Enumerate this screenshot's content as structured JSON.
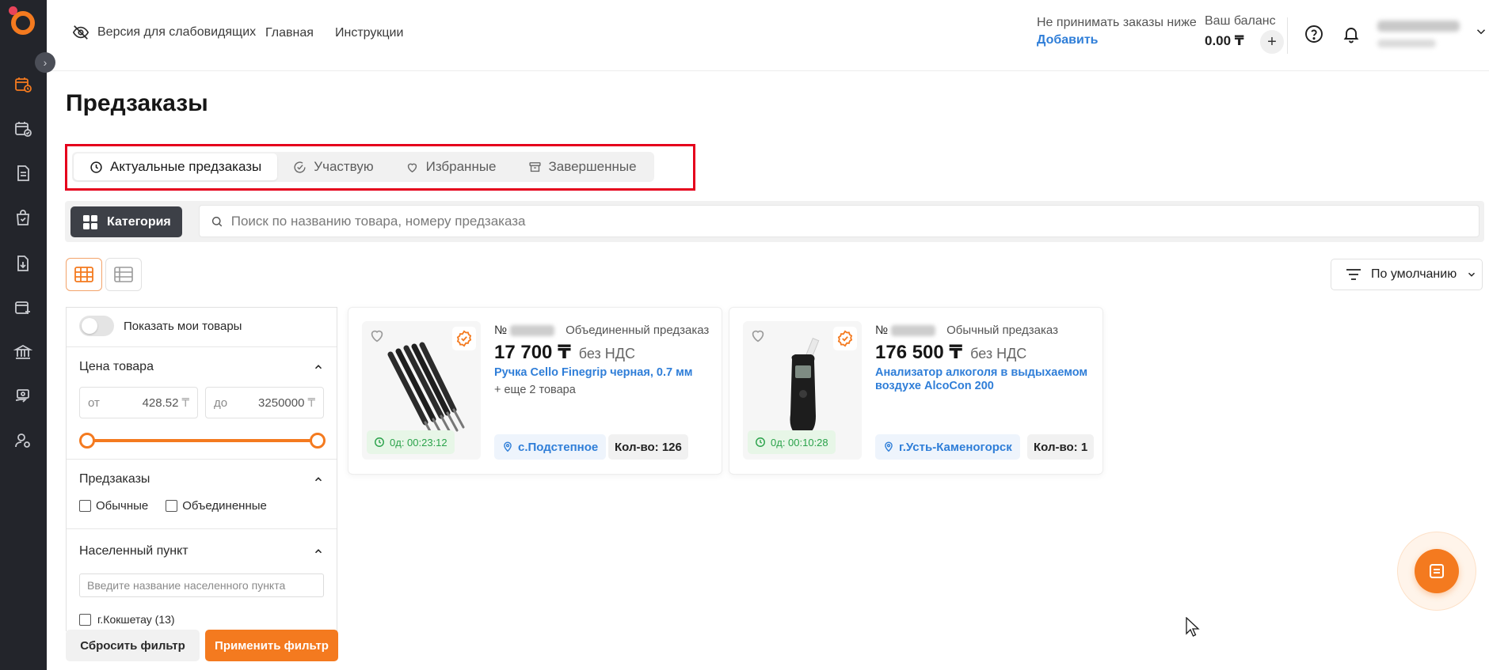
{
  "header": {
    "accessibility_label": "Версия для слабовидящих",
    "nav": [
      "Главная",
      "Инструкции"
    ],
    "min_order_label": "Не принимать заказы ниже",
    "min_order_action": "Добавить",
    "balance_label": "Ваш баланс",
    "balance_value": "0.00 ₸",
    "balance_add": "+"
  },
  "page": {
    "title": "Предзаказы"
  },
  "tabs": [
    {
      "label": "Актуальные предзаказы",
      "icon": "clock-icon",
      "active": true
    },
    {
      "label": "Участвую",
      "icon": "check-circle-icon",
      "active": false
    },
    {
      "label": "Избранные",
      "icon": "heart-icon",
      "active": false
    },
    {
      "label": "Завершенные",
      "icon": "archive-icon",
      "active": false
    }
  ],
  "search": {
    "category_label": "Категория",
    "placeholder": "Поиск по названию товара, номеру предзаказа"
  },
  "sort": {
    "label": "По умолчанию"
  },
  "filters": {
    "show_my_label": "Показать мои товары",
    "show_my_on": false,
    "price": {
      "title": "Цена товара",
      "from_label": "от",
      "from_value": "428.52",
      "to_label": "до",
      "to_value": "3250000",
      "currency": "₸",
      "slider_min": 0,
      "slider_max": 1
    },
    "preorders": {
      "title": "Предзаказы",
      "options": [
        "Обычные",
        "Объединенные"
      ]
    },
    "city": {
      "title": "Населенный пункт",
      "placeholder": "Введите название населенного пункта",
      "options": [
        "г.Кокшетау (13)"
      ]
    },
    "reset_label": "Сбросить фильтр",
    "apply_label": "Применить фильтр"
  },
  "cards": [
    {
      "number_prefix": "№",
      "type": "Объединенный предзаказ",
      "price": "17 700 ₸",
      "vat": "без НДС",
      "name": "Ручка Cello Finegrip черная, 0.7 мм",
      "more": "+ еще 2 товара",
      "timer": "0д: 00:23:12",
      "location": "с.Подстепное",
      "qty": "Кол-во: 126"
    },
    {
      "number_prefix": "№",
      "type": "Обычный предзаказ",
      "price": "176 500 ₸",
      "vat": "без НДС",
      "name": "Анализатор алкоголя в выдыхаемом воздухе AlcoCon 200",
      "more": "",
      "timer": "0д: 00:10:28",
      "location": "г.Усть-Каменогорск",
      "qty": "Кол-во: 1"
    }
  ],
  "colors": {
    "accent": "#f47a1f",
    "link": "#2f7ed8",
    "sidebar": "#23252b",
    "highlight": "#e5001c",
    "timer": "#2aa24a"
  }
}
